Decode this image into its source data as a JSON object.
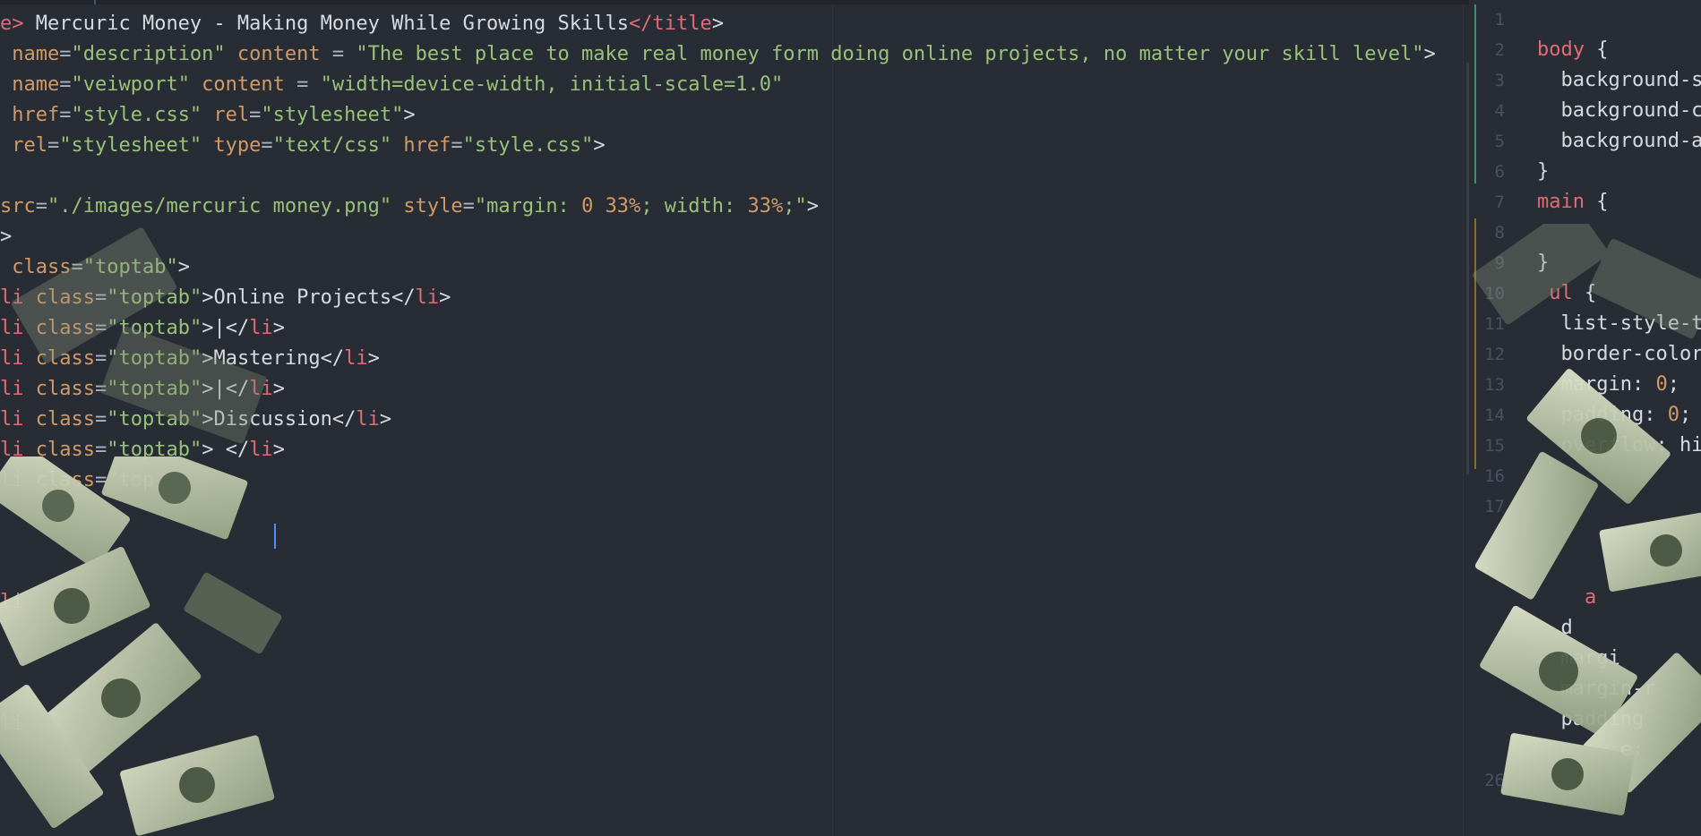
{
  "editor_left": {
    "lines": [
      [
        [
          "t",
          "e>"
        ],
        [
          "x",
          " Mercuric Money - Making Money While Growing Skills"
        ],
        [
          "t",
          "</title"
        ],
        [
          "x",
          ">"
        ]
      ],
      [
        [
          "a",
          " name"
        ],
        [
          "p",
          "="
        ],
        [
          "s",
          "\"description\""
        ],
        [
          "a",
          " content"
        ],
        [
          "p",
          " = "
        ],
        [
          "s",
          "\"The best place to make real money form doing online projects, no matter your skill level\""
        ],
        [
          "x",
          ">"
        ]
      ],
      [
        [
          "a",
          " name"
        ],
        [
          "p",
          "="
        ],
        [
          "s",
          "\"veiwport\""
        ],
        [
          "a",
          " content"
        ],
        [
          "p",
          " = "
        ],
        [
          "s",
          "\"width=device-width, initial-scale=1.0\""
        ]
      ],
      [
        [
          "a",
          " href"
        ],
        [
          "p",
          "="
        ],
        [
          "s",
          "\"style.css\""
        ],
        [
          "a",
          " rel"
        ],
        [
          "p",
          "="
        ],
        [
          "s",
          "\"stylesheet\""
        ],
        [
          "x",
          ">"
        ]
      ],
      [
        [
          "a",
          " rel"
        ],
        [
          "p",
          "="
        ],
        [
          "s",
          "\"stylesheet\""
        ],
        [
          "a",
          " type"
        ],
        [
          "p",
          "="
        ],
        [
          "s",
          "\"text/css\""
        ],
        [
          "a",
          " href"
        ],
        [
          "p",
          "="
        ],
        [
          "s",
          "\"style.css\""
        ],
        [
          "x",
          ">"
        ]
      ],
      [],
      [
        [
          "a",
          "src"
        ],
        [
          "p",
          "="
        ],
        [
          "s",
          "\"./images/mercuric money.png\""
        ],
        [
          "a",
          " style"
        ],
        [
          "p",
          "="
        ],
        [
          "s",
          "\"margin: "
        ],
        [
          "n",
          "0"
        ],
        [
          "s",
          " "
        ],
        [
          "n",
          "33%"
        ],
        [
          "s",
          "; width: "
        ],
        [
          "n",
          "33%"
        ],
        [
          "s",
          ";\""
        ],
        [
          "x",
          ">"
        ]
      ],
      [
        [
          "x",
          ">"
        ]
      ],
      [
        [
          "a",
          " class"
        ],
        [
          "p",
          "="
        ],
        [
          "s",
          "\"toptab\""
        ],
        [
          "x",
          ">"
        ]
      ],
      [
        [
          "t",
          "li"
        ],
        [
          "a",
          " class"
        ],
        [
          "p",
          "="
        ],
        [
          "s",
          "\"toptab\""
        ],
        [
          "x",
          ">Online Projects</"
        ],
        [
          "t",
          "li"
        ],
        [
          "x",
          ">"
        ]
      ],
      [
        [
          "t",
          "li"
        ],
        [
          "a",
          " class"
        ],
        [
          "p",
          "="
        ],
        [
          "s",
          "\"toptab\""
        ],
        [
          "x",
          ">|</"
        ],
        [
          "t",
          "li"
        ],
        [
          "x",
          ">"
        ]
      ],
      [
        [
          "t",
          "li"
        ],
        [
          "a",
          " class"
        ],
        [
          "p",
          "="
        ],
        [
          "s",
          "\"toptab\""
        ],
        [
          "x",
          ">Mastering</"
        ],
        [
          "t",
          "li"
        ],
        [
          "x",
          ">"
        ]
      ],
      [
        [
          "t",
          "li"
        ],
        [
          "a",
          " class"
        ],
        [
          "p",
          "="
        ],
        [
          "s",
          "\"toptab\""
        ],
        [
          "x",
          ">|</"
        ],
        [
          "t",
          "li"
        ],
        [
          "x",
          ">"
        ]
      ],
      [
        [
          "t",
          "li"
        ],
        [
          "a",
          " class"
        ],
        [
          "p",
          "="
        ],
        [
          "s",
          "\"toptab\""
        ],
        [
          "x",
          ">Discussion</"
        ],
        [
          "t",
          "li"
        ],
        [
          "x",
          ">"
        ]
      ],
      [
        [
          "t",
          "li"
        ],
        [
          "a",
          " class"
        ],
        [
          "p",
          "="
        ],
        [
          "s",
          "\"toptab\""
        ],
        [
          "x",
          "> </"
        ],
        [
          "t",
          "li"
        ],
        [
          "x",
          ">"
        ]
      ],
      [
        [
          "t",
          "li"
        ],
        [
          "a",
          " class"
        ],
        [
          "p",
          "="
        ],
        [
          "s",
          "\"top"
        ]
      ],
      [],
      [],
      [],
      [
        [
          "t",
          "li"
        ]
      ],
      [],
      [],
      [],
      [
        [
          "t",
          "li"
        ]
      ],
      [],
      [],
      []
    ]
  },
  "editor_right": {
    "lines": [
      {
        "num": "1",
        "code": []
      },
      {
        "num": "2",
        "code": [
          [
            "sel",
            "body"
          ],
          [
            "x",
            " {"
          ]
        ]
      },
      {
        "num": "3",
        "code": [
          [
            "prop",
            "  background-si"
          ]
        ]
      },
      {
        "num": "4",
        "code": [
          [
            "prop",
            "  background-co"
          ]
        ]
      },
      {
        "num": "5",
        "code": [
          [
            "prop",
            "  background-at"
          ]
        ]
      },
      {
        "num": "6",
        "code": [
          [
            "x",
            "}"
          ]
        ]
      },
      {
        "num": "7",
        "code": [
          [
            "sel",
            "main"
          ],
          [
            "x",
            " {"
          ]
        ]
      },
      {
        "num": "8",
        "code": []
      },
      {
        "num": "9",
        "code": [
          [
            "x",
            "}"
          ]
        ]
      },
      {
        "num": "10",
        "code": [
          [
            "sel",
            " ul"
          ],
          [
            "x",
            " {"
          ]
        ]
      },
      {
        "num": "11",
        "code": [
          [
            "prop",
            "  list-style-ty"
          ]
        ]
      },
      {
        "num": "12",
        "code": [
          [
            "prop",
            "  border-color"
          ]
        ]
      },
      {
        "num": "13",
        "code": [
          [
            "prop",
            "  margin: "
          ],
          [
            "n",
            "0"
          ],
          [
            "x",
            ";"
          ]
        ]
      },
      {
        "num": "14",
        "code": [
          [
            "prop",
            "  padding: "
          ],
          [
            "n",
            "0"
          ],
          [
            "x",
            ";"
          ]
        ]
      },
      {
        "num": "15",
        "code": [
          [
            "prop",
            "  overflow: hi"
          ]
        ]
      },
      {
        "num": "16",
        "code": []
      },
      {
        "num": "17",
        "code": []
      },
      {
        "num": "",
        "code": []
      },
      {
        "num": "",
        "code": []
      },
      {
        "num": "",
        "code": [
          [
            "sel",
            "    a"
          ]
        ]
      },
      {
        "num": "",
        "code": [
          [
            "prop",
            "  d"
          ]
        ]
      },
      {
        "num": "",
        "code": [
          [
            "prop",
            "  margi"
          ]
        ]
      },
      {
        "num": "",
        "code": [
          [
            "prop",
            "  margin-r"
          ]
        ]
      },
      {
        "num": "",
        "code": [
          [
            "prop",
            "  padding"
          ]
        ]
      },
      {
        "num": "",
        "code": [
          [
            "prop",
            "       e:"
          ]
        ]
      },
      {
        "num": "26",
        "code": []
      }
    ]
  },
  "icons": [
    "money-bill-icon"
  ]
}
